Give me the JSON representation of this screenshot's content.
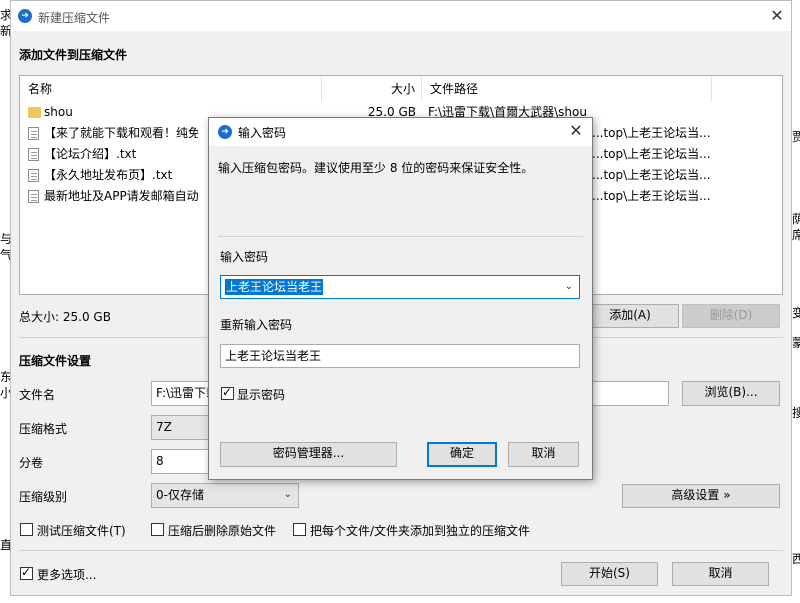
{
  "background": {
    "left_chars": [
      "求",
      "新",
      "与",
      "气",
      "东",
      "小",
      "直"
    ],
    "right_chars": [
      "贾",
      "荫",
      "席",
      "变",
      "蒙",
      "搜",
      "西"
    ]
  },
  "window": {
    "title": "新建压缩文件",
    "close_symbol": "✕",
    "add_section_title": "添加文件到压缩文件",
    "columns": {
      "name": "名称",
      "size": "大小",
      "path": "文件路径"
    },
    "files": [
      {
        "name": "shou",
        "size": "25.0 GB",
        "path": "F:\\迅雷下载\\首爾大武器\\shou",
        "type": "folder"
      },
      {
        "name": "【来了就能下载和观看！纯免费",
        "size": "",
        "path": "...top\\上老王论坛当...",
        "type": "file"
      },
      {
        "name": "【论坛介绍】.txt",
        "size": "",
        "path": "...top\\上老王论坛当...",
        "type": "file"
      },
      {
        "name": "【永久地址发布页】.txt",
        "size": "",
        "path": "...top\\上老王论坛当...",
        "type": "file"
      },
      {
        "name": "最新地址及APP请发邮箱自动获",
        "size": "",
        "path": "...top\\上老王论坛当...",
        "type": "file"
      }
    ],
    "total_size": "总大小: 25.0 GB",
    "add_button": "添加(A)",
    "delete_button": "删除(D)",
    "settings_title": "压缩文件设置",
    "filename_label": "文件名",
    "filename_value": "F:\\迅雷下载",
    "browse_button": "浏览(B)...",
    "format_label": "压缩格式",
    "format_value": "7Z",
    "split_label": "分卷",
    "split_value": "8",
    "level_label": "压缩级别",
    "level_value": "0-仅存储",
    "advanced_button": "高级设置 »",
    "test_checkbox": "测试压缩文件(T)",
    "delete_after_checkbox": "压缩后删除原始文件",
    "each_file_checkbox": "把每个文件/文件夹添加到独立的压缩文件",
    "more_options": "更多选项...",
    "start_button": "开始(S)",
    "cancel_button": "取消"
  },
  "dialog": {
    "title": "输入密码",
    "close_symbol": "✕",
    "description": "输入压缩包密码。建议使用至少 8 位的密码来保证安全性。",
    "password_label": "输入密码",
    "password_value": "上老王论坛当老王",
    "reenter_label": "重新输入密码",
    "reenter_value": "上老王论坛当老王",
    "show_password": "显示密码",
    "manager_button": "密码管理器...",
    "ok_button": "确定",
    "cancel_button": "取消"
  },
  "colors": {
    "accent": "#0078d7",
    "folder": "#f2c55c",
    "window_bg": "#f0f0f0"
  }
}
